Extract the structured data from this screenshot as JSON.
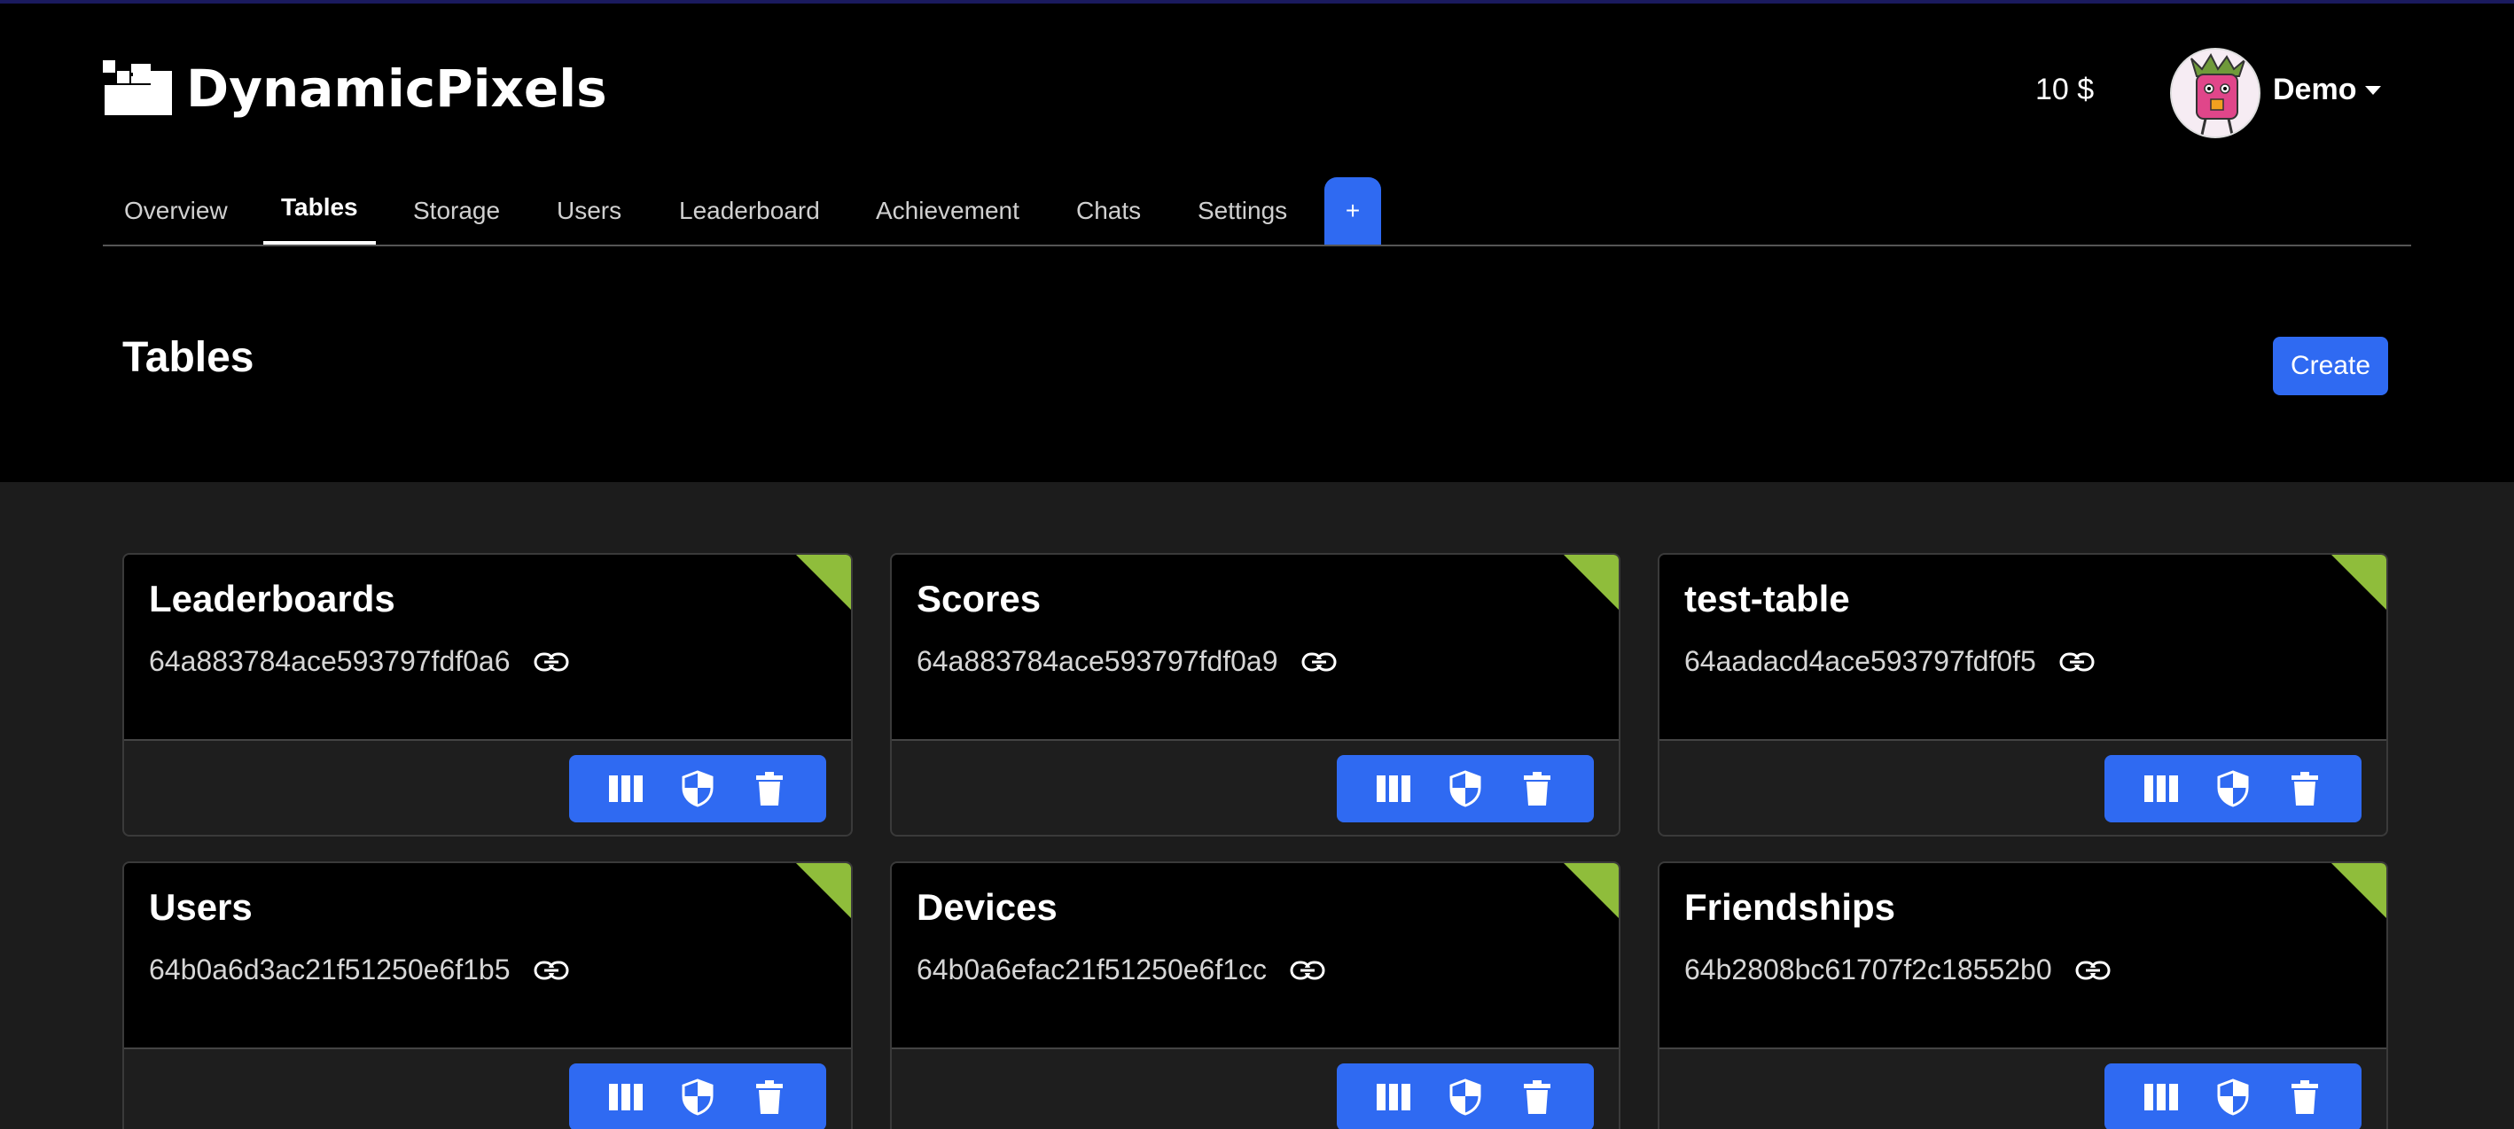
{
  "brand": {
    "name": "DynamicPixels"
  },
  "header": {
    "balance": "10 $",
    "username": "Demo"
  },
  "tabs": [
    {
      "label": "Overview"
    },
    {
      "label": "Tables"
    },
    {
      "label": "Storage"
    },
    {
      "label": "Users"
    },
    {
      "label": "Leaderboard"
    },
    {
      "label": "Achievement"
    },
    {
      "label": "Chats"
    },
    {
      "label": "Settings"
    }
  ],
  "tab_add_label": "+",
  "page": {
    "title": "Tables",
    "create_label": "Create"
  },
  "tables": [
    {
      "name": "Leaderboards",
      "id": "64a883784ace593797fdf0a6"
    },
    {
      "name": "Scores",
      "id": "64a883784ace593797fdf0a9"
    },
    {
      "name": "test-table",
      "id": "64aadacd4ace593797fdf0f5"
    },
    {
      "name": "Users",
      "id": "64b0a6d3ac21f51250e6f1b5"
    },
    {
      "name": "Devices",
      "id": "64b0a6efac21f51250e6f1cc"
    },
    {
      "name": "Friendships",
      "id": "64b2808bc61707f2c18552b0"
    }
  ],
  "colors": {
    "accent": "#2f6af2",
    "status_corner": "#8fbd3b",
    "header_bg": "#000000",
    "body_bg": "#1c1c1c"
  },
  "icons": {
    "card_link": "link-icon",
    "action_1": "columns-icon",
    "action_2": "shield-icon",
    "action_3": "trash-icon"
  }
}
